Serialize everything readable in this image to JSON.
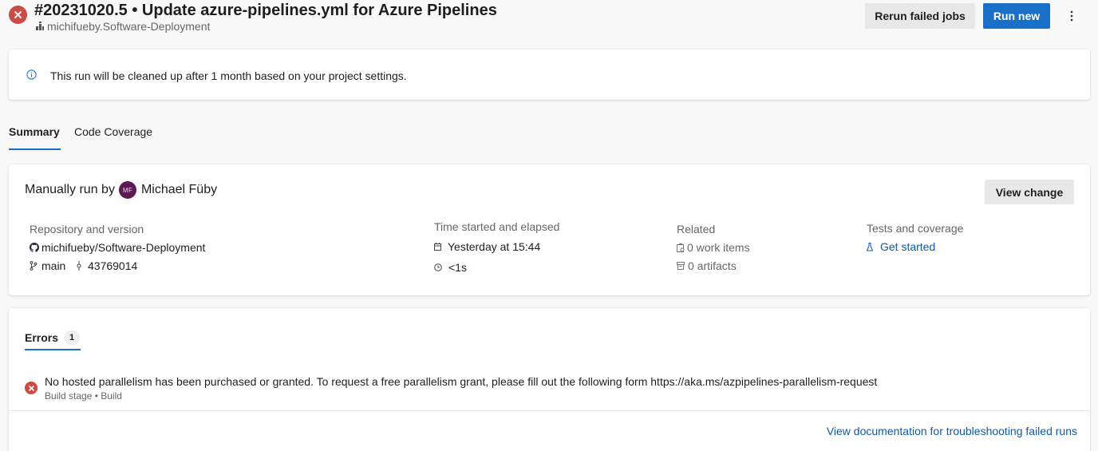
{
  "header": {
    "title": "#20231020.5 • Update azure-pipelines.yml for Azure Pipelines",
    "subtitle": "michifueby.Software-Deployment",
    "rerun_label": "Rerun failed jobs",
    "run_new_label": "Run new"
  },
  "banner": {
    "text": "This run will be cleaned up after 1 month based on your project settings."
  },
  "tabs": [
    {
      "label": "Summary",
      "active": true
    },
    {
      "label": "Code Coverage",
      "active": false
    }
  ],
  "summary": {
    "run_by_prefix": "Manually run by",
    "avatar_initials": "MF",
    "run_by_name": "Michael Füby",
    "view_change_label": "View change",
    "repo": {
      "heading": "Repository and version",
      "name": "michifueby/Software-Deployment",
      "branch": "main",
      "commit": "43769014"
    },
    "time": {
      "heading": "Time started and elapsed",
      "started": "Yesterday at 15:44",
      "elapsed": "<1s"
    },
    "related": {
      "heading": "Related",
      "work_items": "0 work items",
      "artifacts": "0 artifacts"
    },
    "tests": {
      "heading": "Tests and coverage",
      "link": "Get started"
    }
  },
  "errors": {
    "tab_label": "Errors",
    "count": "1",
    "items": [
      {
        "message": "No hosted parallelism has been purchased or granted. To request a free parallelism grant, please fill out the following form https://aka.ms/azpipelines-parallelism-request",
        "source": "Build stage • Build"
      }
    ],
    "footer_link": "View documentation for troubleshooting failed runs"
  },
  "colors": {
    "error_red": "#cd4a45",
    "primary_blue": "#1a6fc9",
    "link_blue": "#0f5aa8",
    "avatar_purple": "#5c1a52"
  }
}
